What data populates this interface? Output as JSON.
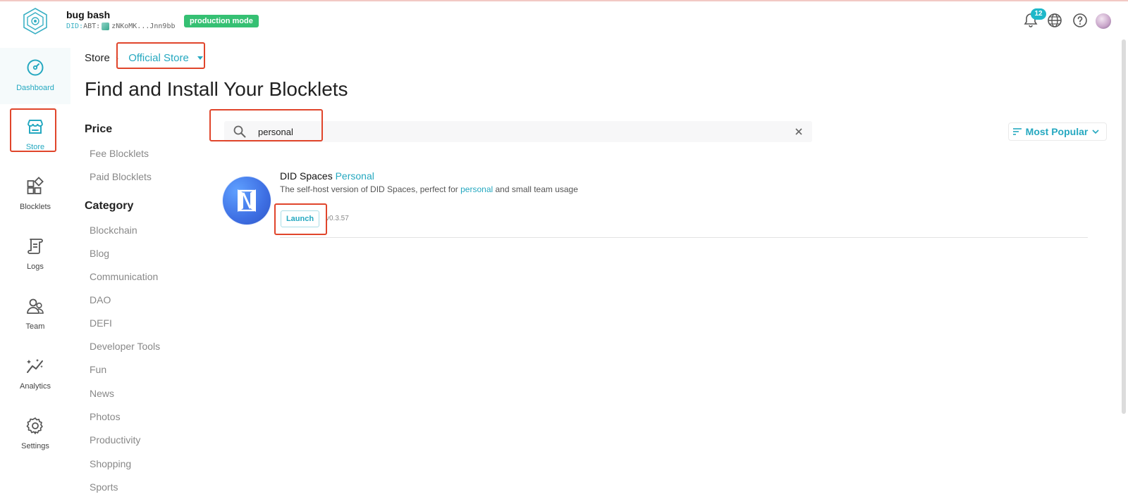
{
  "header": {
    "app_title": "bug bash",
    "did_prefix": "DID:",
    "did_type": "ABT:",
    "did_value": "zNKoMK...Jnn9bb",
    "mode_badge": "production mode",
    "notification_count": "12",
    "icons": [
      "bell-icon",
      "globe-icon",
      "help-icon",
      "user-avatar"
    ]
  },
  "sidebar": {
    "items": [
      {
        "label": "Dashboard",
        "icon": "dashboard-icon"
      },
      {
        "label": "Store",
        "icon": "store-icon",
        "active": true
      },
      {
        "label": "Blocklets",
        "icon": "blocklets-icon"
      },
      {
        "label": "Logs",
        "icon": "logs-icon"
      },
      {
        "label": "Team",
        "icon": "team-icon"
      },
      {
        "label": "Analytics",
        "icon": "analytics-icon"
      },
      {
        "label": "Settings",
        "icon": "settings-icon"
      }
    ]
  },
  "breadcrumb": {
    "root": "Store",
    "separator": "›",
    "selected_store": "Official Store"
  },
  "page_title": "Find and Install Your Blocklets",
  "filters": {
    "price_heading": "Price",
    "price_items": [
      "Fee Blocklets",
      "Paid Blocklets"
    ],
    "category_heading": "Category",
    "category_items": [
      "Blockchain",
      "Blog",
      "Communication",
      "DAO",
      "DEFI",
      "Developer Tools",
      "Fun",
      "News",
      "Photos",
      "Productivity",
      "Shopping",
      "Sports"
    ]
  },
  "search": {
    "value": "personal",
    "placeholder": ""
  },
  "sort": {
    "label": "Most Popular"
  },
  "results": [
    {
      "title_main": "DID Spaces",
      "title_highlight": "Personal",
      "desc_before": "The self-host version of DID Spaces, perfect for",
      "desc_highlight": "personal",
      "desc_after": "and small team usage",
      "action_label": "Launch",
      "version": "v0.3.57"
    }
  ],
  "colors": {
    "accent": "#25a8c0",
    "badge_green": "#35c073",
    "annotation_red": "#e0452b"
  }
}
